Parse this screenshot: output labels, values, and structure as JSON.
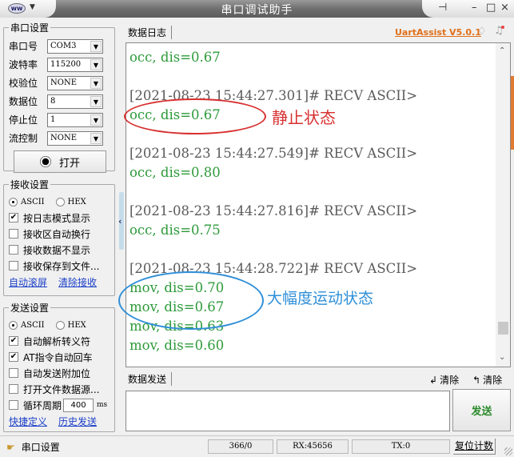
{
  "window": {
    "title": "串口调试助手",
    "app_icon": "app-logo-icon",
    "pin_icon": "⊣",
    "minimize": "–",
    "maximize": "□",
    "close": "×"
  },
  "serial_settings": {
    "legend": "串口设置",
    "fields": [
      {
        "label": "串口号",
        "value": "COM3"
      },
      {
        "label": "波特率",
        "value": "115200"
      },
      {
        "label": "校验位",
        "value": "NONE"
      },
      {
        "label": "数据位",
        "value": "8"
      },
      {
        "label": "停止位",
        "value": "1"
      },
      {
        "label": "流控制",
        "value": "NONE"
      }
    ],
    "open_button": "打开"
  },
  "receive_settings": {
    "legend": "接收设置",
    "mode_ascii": "ASCII",
    "mode_hex": "HEX",
    "mode_selected": "ASCII",
    "options": [
      {
        "label": "按日志模式显示",
        "checked": true
      },
      {
        "label": "接收区自动换行",
        "checked": false
      },
      {
        "label": "接收数据不显示",
        "checked": false
      },
      {
        "label": "接收保存到文件...",
        "checked": false
      }
    ],
    "links": [
      "自动滚屏",
      "清除接收"
    ]
  },
  "send_settings": {
    "legend": "发送设置",
    "mode_ascii": "ASCII",
    "mode_hex": "HEX",
    "mode_selected": "ASCII",
    "options": [
      {
        "label": "自动解析转义符",
        "checked": true
      },
      {
        "label": "AT指令自动回车",
        "checked": true
      },
      {
        "label": "自动发送附加位",
        "checked": false
      },
      {
        "label": "打开文件数据源...",
        "checked": false
      }
    ],
    "cycle": {
      "label": "循环周期",
      "value": "400",
      "unit": "ms",
      "checked": false
    },
    "links": [
      "快捷定义",
      "历史发送"
    ]
  },
  "log": {
    "tab": "数据日志",
    "version_link": "UartAssist V5.0.1",
    "lines": [
      {
        "type": "dat",
        "text": "occ, dis=0.67"
      },
      {
        "type": "blank",
        "text": ""
      },
      {
        "type": "hdr",
        "text": "[2021-08-23 15:44:27.301]# RECV ASCII>"
      },
      {
        "type": "dat",
        "text": "occ, dis=0.67"
      },
      {
        "type": "blank",
        "text": ""
      },
      {
        "type": "hdr",
        "text": "[2021-08-23 15:44:27.549]# RECV ASCII>"
      },
      {
        "type": "dat",
        "text": "occ, dis=0.80"
      },
      {
        "type": "blank",
        "text": ""
      },
      {
        "type": "hdr",
        "text": "[2021-08-23 15:44:27.816]# RECV ASCII>"
      },
      {
        "type": "dat",
        "text": "occ, dis=0.75"
      },
      {
        "type": "blank",
        "text": ""
      },
      {
        "type": "hdr",
        "text": "[2021-08-23 15:44:28.722]# RECV ASCII>"
      },
      {
        "type": "dat",
        "text": "mov, dis=0.70"
      },
      {
        "type": "dat",
        "text": "mov, dis=0.67"
      },
      {
        "type": "dat",
        "text": "mov, dis=0.63"
      },
      {
        "type": "dat",
        "text": "mov, dis=0.60"
      }
    ],
    "annotations": {
      "static": "静止状态",
      "motion": "大幅度运动状态",
      "static_color": "#d83030",
      "motion_color": "#2f8fd8"
    }
  },
  "send": {
    "tab": "数据发送",
    "clear_rx": "清除",
    "clear_tx": "清除",
    "input_value": "",
    "send_button": "发送"
  },
  "status": {
    "port_label": "串口设置",
    "count": "366/0",
    "rx": "RX:45656",
    "tx": "TX:0",
    "reset": "复位计数"
  },
  "colors": {
    "data_text": "#2d9a3a",
    "header_text": "#5a5a5a",
    "version_link": "#e0701a",
    "link": "#1a3fc8",
    "send_button_text": "#2a8a2a"
  }
}
